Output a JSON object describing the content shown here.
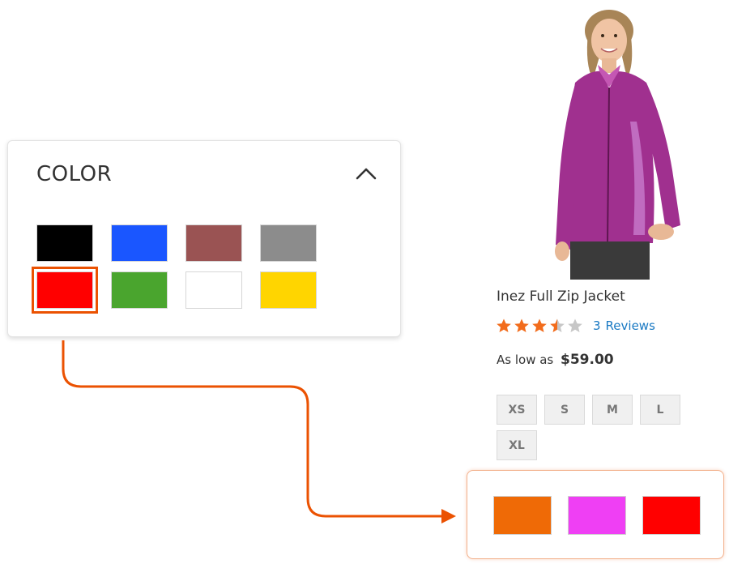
{
  "color_filter": {
    "title": "COLOR",
    "collapse_icon": "chevron-up-icon",
    "swatches": [
      {
        "name": "black",
        "color": "#000000"
      },
      {
        "name": "blue",
        "color": "#1a56ff"
      },
      {
        "name": "brown",
        "color": "#9a5353"
      },
      {
        "name": "gray",
        "color": "#8c8c8c"
      },
      {
        "name": "red",
        "color": "#ff0000",
        "selected": true
      },
      {
        "name": "green",
        "color": "#4aa52e"
      },
      {
        "name": "white",
        "color": "#ffffff"
      },
      {
        "name": "yellow",
        "color": "#ffd500"
      }
    ]
  },
  "product": {
    "name": "Inez Full Zip Jacket",
    "rating_out_of_5": 3.5,
    "review_count": "3",
    "reviews_label": "Reviews",
    "price_prefix": "As low as",
    "price": "$59.00",
    "sizes": [
      "XS",
      "S",
      "M",
      "L",
      "XL"
    ],
    "available_colors": [
      {
        "name": "orange",
        "color": "#ef6a06"
      },
      {
        "name": "purple",
        "color": "#ef3ff4"
      },
      {
        "name": "red",
        "color": "#ff0000"
      }
    ]
  },
  "accent_color": "#eb5202",
  "link_color": "#1979c3",
  "star_color": "#f26c1c"
}
